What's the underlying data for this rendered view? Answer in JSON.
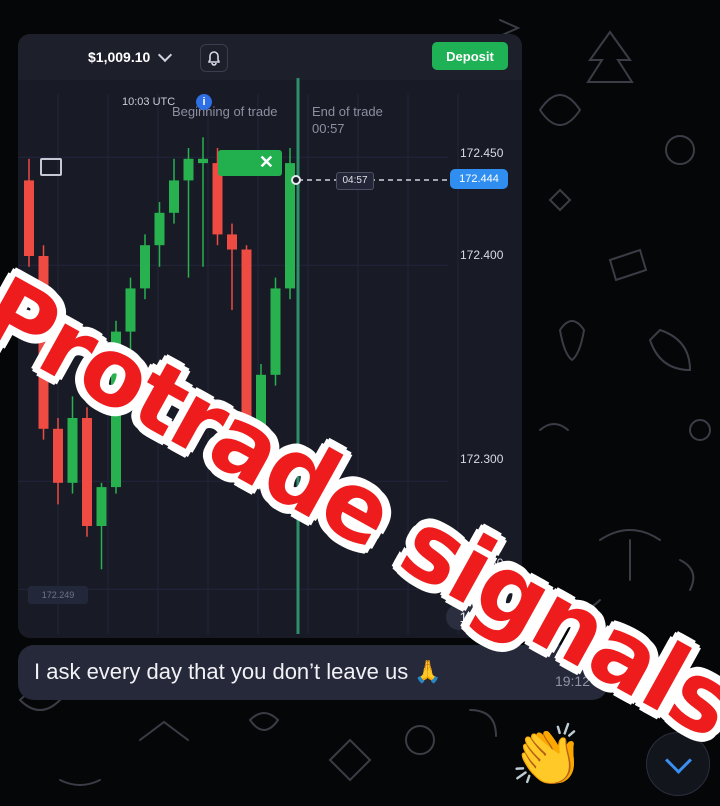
{
  "balance": "$1,009.10",
  "deposit_label": "Deposit",
  "chart_header": {
    "clock": "10:03 UTC",
    "begin_label": "Beginning of trade",
    "end_label": "End of trade",
    "end_time": "00:57",
    "info_label": "i"
  },
  "trade_tag_label": "✕",
  "price_axis": [
    "172.450",
    "172.400",
    "172.300",
    "172.250"
  ],
  "current_price": "172.444",
  "countdown": "04:57",
  "min_price_label": "172.249",
  "screenshot_time": "19:12",
  "chart_data": {
    "type": "candlestick",
    "ylim": [
      172.22,
      172.47
    ],
    "y_ticks": [
      172.45,
      172.4,
      172.3,
      172.25
    ],
    "current_price": 172.444,
    "candles": [
      {
        "o": 172.43,
        "c": 172.395,
        "h": 172.44,
        "l": 172.39,
        "color": "red"
      },
      {
        "o": 172.395,
        "c": 172.315,
        "h": 172.4,
        "l": 172.31,
        "color": "red"
      },
      {
        "o": 172.315,
        "c": 172.29,
        "h": 172.32,
        "l": 172.28,
        "color": "red"
      },
      {
        "o": 172.29,
        "c": 172.32,
        "h": 172.33,
        "l": 172.285,
        "color": "green"
      },
      {
        "o": 172.32,
        "c": 172.27,
        "h": 172.325,
        "l": 172.265,
        "color": "red"
      },
      {
        "o": 172.27,
        "c": 172.288,
        "h": 172.29,
        "l": 172.25,
        "color": "green"
      },
      {
        "o": 172.288,
        "c": 172.36,
        "h": 172.365,
        "l": 172.285,
        "color": "green"
      },
      {
        "o": 172.36,
        "c": 172.38,
        "h": 172.385,
        "l": 172.35,
        "color": "green"
      },
      {
        "o": 172.38,
        "c": 172.4,
        "h": 172.405,
        "l": 172.375,
        "color": "green"
      },
      {
        "o": 172.4,
        "c": 172.415,
        "h": 172.42,
        "l": 172.39,
        "color": "green"
      },
      {
        "o": 172.415,
        "c": 172.43,
        "h": 172.44,
        "l": 172.41,
        "color": "green"
      },
      {
        "o": 172.43,
        "c": 172.44,
        "h": 172.445,
        "l": 172.385,
        "color": "green"
      },
      {
        "o": 172.44,
        "c": 172.438,
        "h": 172.45,
        "l": 172.39,
        "color": "green"
      },
      {
        "o": 172.438,
        "c": 172.405,
        "h": 172.445,
        "l": 172.4,
        "color": "red"
      },
      {
        "o": 172.405,
        "c": 172.398,
        "h": 172.41,
        "l": 172.37,
        "color": "red"
      },
      {
        "o": 172.398,
        "c": 172.305,
        "h": 172.4,
        "l": 172.3,
        "color": "red"
      },
      {
        "o": 172.305,
        "c": 172.34,
        "h": 172.345,
        "l": 172.295,
        "color": "green"
      },
      {
        "o": 172.34,
        "c": 172.38,
        "h": 172.385,
        "l": 172.335,
        "color": "green"
      },
      {
        "o": 172.38,
        "c": 172.438,
        "h": 172.445,
        "l": 172.375,
        "color": "green"
      }
    ]
  },
  "message": {
    "text": "I ask every day that you don’t leave us 🙏",
    "time": "19:12"
  },
  "watermark": "Protrade signals",
  "colors": {
    "up": "#27b24f",
    "down": "#ee4b43",
    "accent": "#2f8ef0",
    "deposit": "#1fb155",
    "watermark": "#ee1c1c"
  }
}
